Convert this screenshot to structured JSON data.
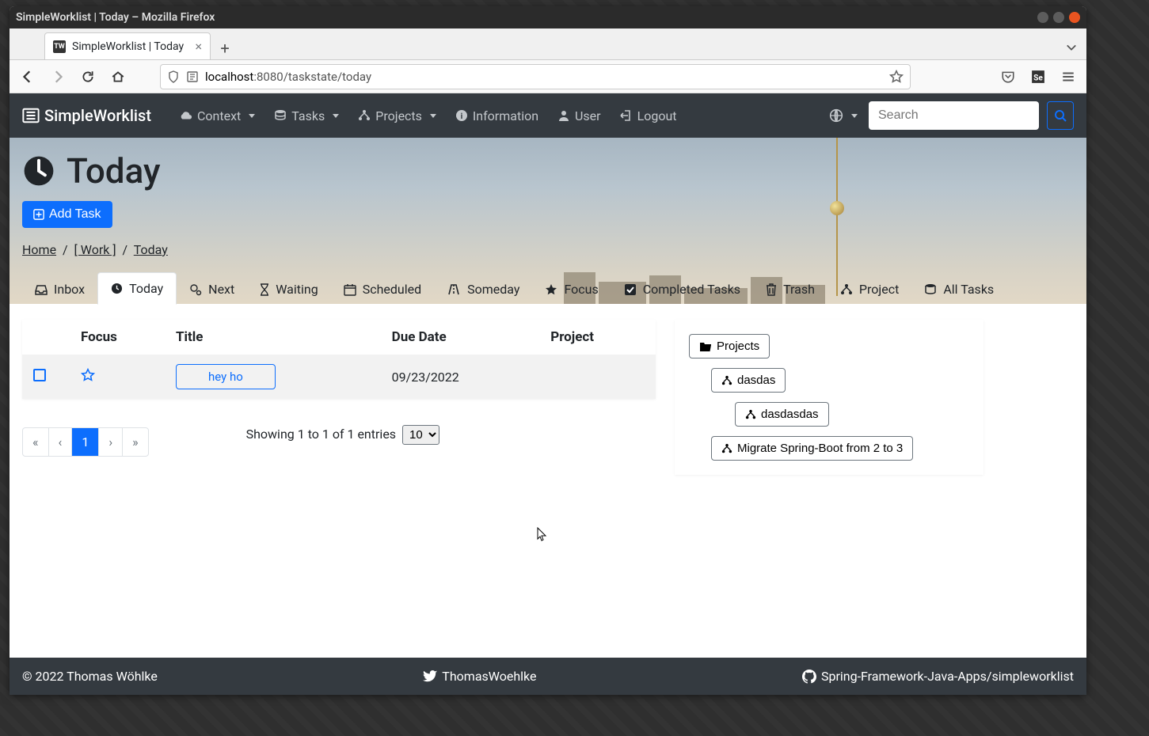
{
  "window": {
    "title": "SimpleWorklist | Today – Mozilla Firefox"
  },
  "tab": {
    "title": "SimpleWorklist | Today",
    "fav": "TW"
  },
  "url": {
    "host": "localhost",
    "port": ":8080",
    "path": "/taskstate/today"
  },
  "nav": {
    "brand": "SimpleWorklist",
    "items": {
      "context": "Context",
      "tasks": "Tasks",
      "projects": "Projects",
      "information": "Information",
      "user": "User",
      "logout": "Logout"
    },
    "search_placeholder": "Search"
  },
  "page": {
    "title": "Today",
    "add_task": "Add Task"
  },
  "breadcrumbs": {
    "home": "Home",
    "context": "[ Work ]",
    "current": "Today"
  },
  "state_tabs": {
    "inbox": "Inbox",
    "today": "Today",
    "next": "Next",
    "waiting": "Waiting",
    "scheduled": "Scheduled",
    "someday": "Someday",
    "focus": "Focus",
    "completed": "Completed Tasks",
    "trash": "Trash",
    "project": "Project",
    "all": "All Tasks"
  },
  "table": {
    "headers": {
      "focus": "Focus",
      "title": "Title",
      "due": "Due Date",
      "project": "Project"
    },
    "rows": [
      {
        "title": "hey ho",
        "due": "09/23/2022",
        "project": ""
      }
    ]
  },
  "pagination": {
    "text_prefix": "Showing 1 to 1 of 1 entries",
    "page_size": "10",
    "first": "«",
    "prev": "‹",
    "current": "1",
    "next": "›",
    "last": "»"
  },
  "project_panel": {
    "root": "Projects",
    "tree": {
      "p1": "dasdas",
      "p2": "dasdasdas",
      "p3": "Migrate Spring-Boot from 2 to 3"
    }
  },
  "footer": {
    "copyright": "© 2022 Thomas Wöhlke",
    "twitter": "ThomasWoehlke",
    "github": "Spring-Framework-Java-Apps/simpleworklist"
  }
}
